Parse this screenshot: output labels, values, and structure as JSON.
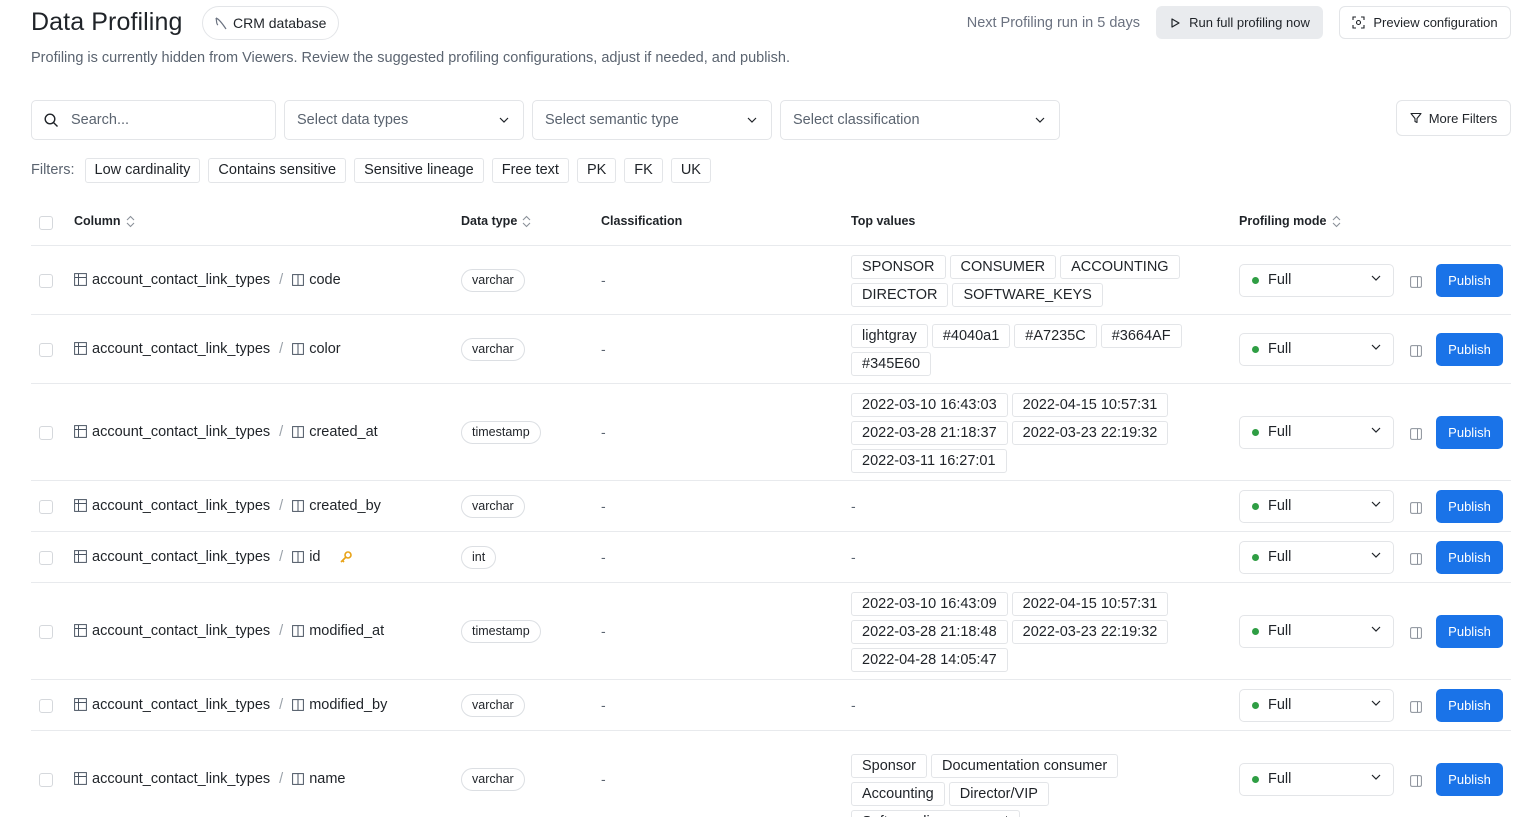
{
  "header": {
    "title": "Data Profiling",
    "database": "CRM database",
    "next_run": "Next Profiling run in 5 days",
    "run_button": "Run full profiling now",
    "preview_button": "Preview configuration"
  },
  "subtitle": "Profiling is currently hidden from Viewers. Review the suggested profiling configurations, adjust if needed, and publish.",
  "filters": {
    "search_placeholder": "Search...",
    "data_types": "Select data types",
    "semantic_type": "Select semantic type",
    "classification": "Select classification",
    "more_filters": "More Filters",
    "label": "Filters:",
    "chips": [
      "Low cardinality",
      "Contains sensitive",
      "Sensitive lineage",
      "Free text",
      "PK",
      "FK",
      "UK"
    ]
  },
  "table": {
    "headers": {
      "column": "Column",
      "data_type": "Data type",
      "classification": "Classification",
      "top_values": "Top values",
      "profiling_mode": "Profiling mode"
    },
    "publish_label": "Publish",
    "rows": [
      {
        "table": "account_contact_link_types",
        "column": "code",
        "type": "varchar",
        "classification": "-",
        "top_values": [
          "SPONSOR",
          "CONSUMER",
          "ACCOUNTING",
          "DIRECTOR",
          "SOFTWARE_KEYS"
        ],
        "mode": "Full"
      },
      {
        "table": "account_contact_link_types",
        "column": "color",
        "type": "varchar",
        "classification": "-",
        "top_values": [
          "lightgray",
          "#4040a1",
          "#A7235C",
          "#3664AF",
          "#345E60"
        ],
        "mode": "Full"
      },
      {
        "table": "account_contact_link_types",
        "column": "created_at",
        "type": "timestamp",
        "classification": "-",
        "top_values": [
          "2022-03-10 16:43:03",
          "2022-04-15 10:57:31",
          "2022-03-28 21:18:37",
          "2022-03-23 22:19:32",
          "2022-03-11 16:27:01"
        ],
        "mode": "Full"
      },
      {
        "table": "account_contact_link_types",
        "column": "created_by",
        "type": "varchar",
        "classification": "-",
        "top_values": [],
        "top_values_empty": "-",
        "mode": "Full"
      },
      {
        "table": "account_contact_link_types",
        "column": "id",
        "type": "int",
        "classification": "-",
        "top_values": [],
        "top_values_empty": "-",
        "mode": "Full",
        "key": true
      },
      {
        "table": "account_contact_link_types",
        "column": "modified_at",
        "type": "timestamp",
        "classification": "-",
        "top_values": [
          "2022-03-10 16:43:09",
          "2022-04-15 10:57:31",
          "2022-03-28 21:18:48",
          "2022-03-23 22:19:32",
          "2022-04-28 14:05:47"
        ],
        "mode": "Full"
      },
      {
        "table": "account_contact_link_types",
        "column": "modified_by",
        "type": "varchar",
        "classification": "-",
        "top_values": [],
        "top_values_empty": "-",
        "mode": "Full"
      },
      {
        "table": "account_contact_link_types",
        "column": "name",
        "type": "varchar",
        "classification": "-",
        "top_values": [
          "Sponsor",
          "Documentation consumer",
          "Accounting",
          "Director/VIP",
          "Software license mgmt"
        ],
        "mode": "Full"
      }
    ]
  },
  "colors": {
    "accent": "#1a73e8",
    "mode_dot": "#2f9e44",
    "key_icon": "#e8a317"
  }
}
